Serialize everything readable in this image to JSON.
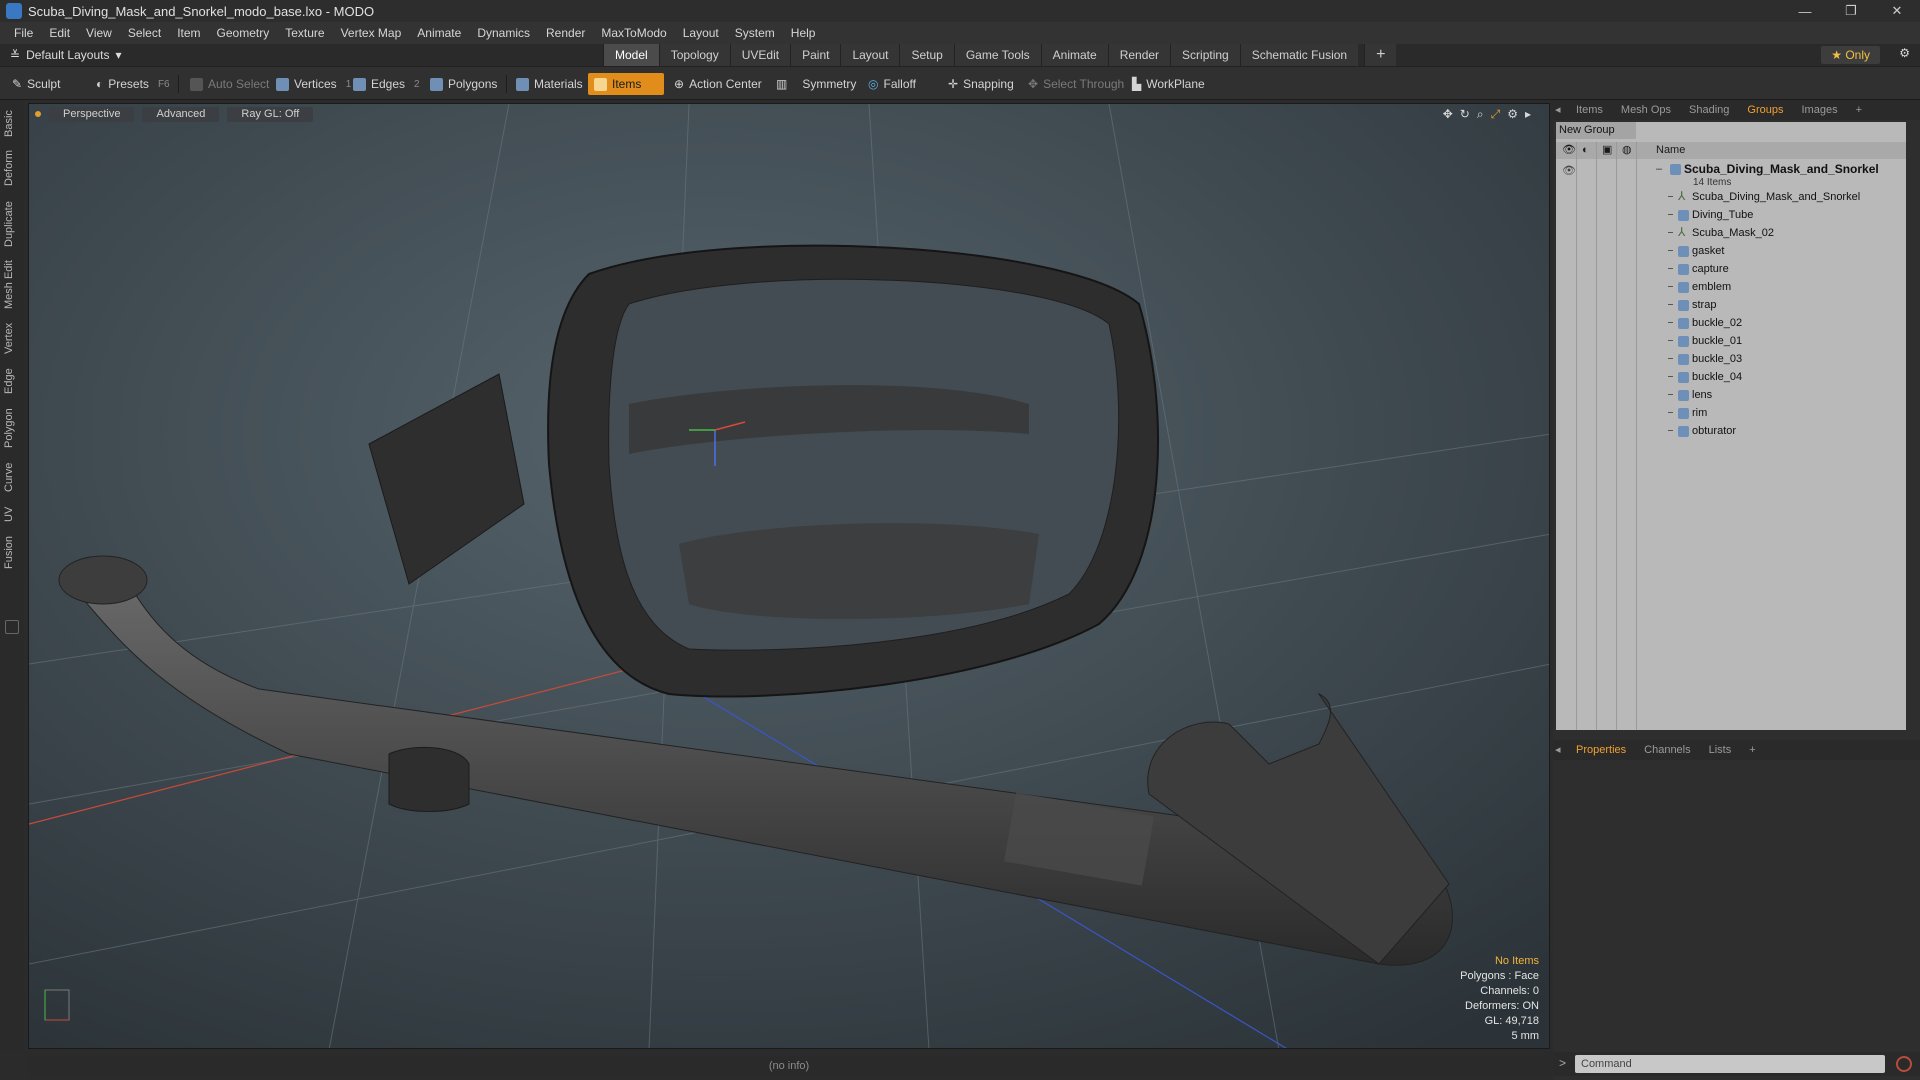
{
  "window": {
    "title": "Scuba_Diving_Mask_and_Snorkel_modo_base.lxo - MODO"
  },
  "menu": [
    "File",
    "Edit",
    "View",
    "Select",
    "Item",
    "Geometry",
    "Texture",
    "Vertex Map",
    "Animate",
    "Dynamics",
    "Render",
    "MaxToModo",
    "Layout",
    "System",
    "Help"
  ],
  "layout": {
    "selector": "Default Layouts",
    "tabs": [
      "Model",
      "Topology",
      "UVEdit",
      "Paint",
      "Layout",
      "Setup",
      "Game Tools",
      "Animate",
      "Render",
      "Scripting",
      "Schematic Fusion"
    ],
    "active_tab": "Model",
    "only_label": "Only"
  },
  "toolbar": {
    "sculpt": "Sculpt",
    "presets": "Presets",
    "presets_key": "F6",
    "auto_select": "Auto Select",
    "vertices": "Vertices",
    "vertices_count": "1",
    "edges": "Edges",
    "edges_count": "2",
    "polygons": "Polygons",
    "materials": "Materials",
    "items": "Items",
    "action_center": "Action Center",
    "symmetry": "Symmetry",
    "falloff": "Falloff",
    "snapping": "Snapping",
    "select_through": "Select Through",
    "workplane": "WorkPlane"
  },
  "left_tabs": [
    "Basic",
    "Deform",
    "Duplicate",
    "Mesh Edit",
    "Vertex",
    "Edge",
    "Polygon",
    "Curve",
    "UV",
    "Fusion"
  ],
  "viewport": {
    "perspective": "Perspective",
    "advanced": "Advanced",
    "raygl": "Ray GL: Off",
    "stats": {
      "items": "No Items",
      "polygons": "Polygons : Face",
      "channels": "Channels: 0",
      "deformers": "Deformers: ON",
      "gl": "GL: 49,718",
      "scale": "5 mm"
    }
  },
  "status": "(no info)",
  "right_panel": {
    "tabs": [
      "Items",
      "Mesh Ops",
      "Shading",
      "Groups",
      "Images"
    ],
    "active_tab": "Groups",
    "new_group": "New Group",
    "name_header": "Name",
    "root": {
      "name": "Scuba_Diving_Mask_and_Snorkel",
      "count": "14 Items"
    },
    "items": [
      "Scuba_Diving_Mask_and_Snorkel",
      "Diving_Tube",
      "Scuba_Mask_02",
      "gasket",
      "capture",
      "emblem",
      "strap",
      "buckle_02",
      "buckle_01",
      "buckle_03",
      "buckle_04",
      "lens",
      "rim",
      "obturator"
    ],
    "bottom_tabs": [
      "Properties",
      "Channels",
      "Lists"
    ],
    "bottom_active": "Properties",
    "command_placeholder": "Command"
  }
}
